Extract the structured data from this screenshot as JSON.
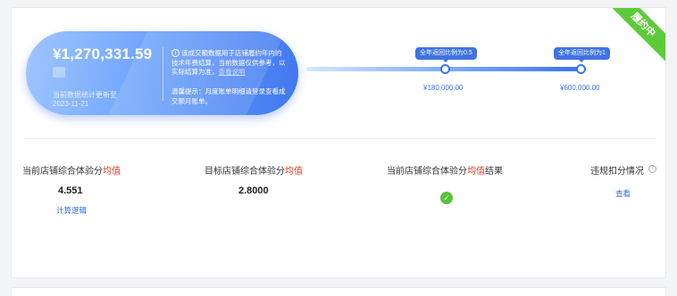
{
  "status_ribbon": "履约中",
  "summary": {
    "amount": "¥1,270,331.59",
    "updated_label": "当前数据统计更新至",
    "updated_date": "2023-11-21",
    "info_text": "该成交额数据用于店铺履约年内的技术年费结算，当前数据仅供参考，以实际结算为准，",
    "info_link": "查看说明",
    "tip_text": "温馨提示：月度账单明细请登录查看成交额月账单。"
  },
  "progress": {
    "nodes": [
      {
        "tag": "全年返回比例为0.5",
        "value": "¥180,000.00"
      },
      {
        "tag": "全年返回比例为1",
        "value": "¥600,000.00"
      }
    ]
  },
  "metrics": {
    "current_avg": {
      "title_prefix": "当前店铺综合体验分",
      "title_highlight": "均值",
      "value": "4.551",
      "link": "计算逻辑"
    },
    "target_avg": {
      "title_prefix": "目标店铺综合体验分",
      "title_highlight": "均值",
      "value": "2.8000"
    },
    "result": {
      "title_prefix": "当前店铺综合体验分",
      "title_highlight": "均值",
      "title_suffix": "结果",
      "icon": "check-circle-icon"
    },
    "violation": {
      "title": "违规扣分情况",
      "link": "查看",
      "icon": "question-circle-icon"
    }
  },
  "colors": {
    "accent": "#3a73ee",
    "highlight": "#e8341c",
    "success": "#58c13a"
  }
}
